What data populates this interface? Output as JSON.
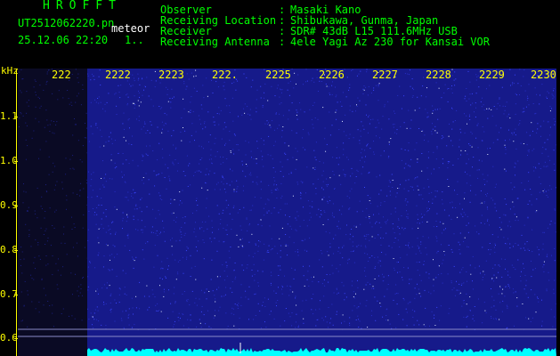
{
  "app": {
    "title": "HROFFT",
    "filename": "UT2512062220.pn",
    "event_type": "meteor",
    "datetime": "25.12.06 22:20",
    "counter": "1..",
    "color": "#00ff00",
    "info_color": "#00ff00",
    "meteor_color": "#ffffff"
  },
  "metadata": [
    {
      "label": "Observer",
      "value": "Masaki Kano"
    },
    {
      "label": "Receiving Location",
      "value": "Shibukawa, Gunma, Japan"
    },
    {
      "label": "Receiver",
      "value": "SDR# 43dB L15 111.6MHz USB"
    },
    {
      "label": "Receiving Antenna",
      "value": "4ele Yagi Az 230 for Kansai VOR"
    }
  ],
  "separator": ":",
  "spectrogram": {
    "unit_label": "kHz",
    "time_labels": [
      "222",
      "2222",
      "2223",
      "222.",
      "2225",
      "2226",
      "2227",
      "2228",
      "2229",
      "2230"
    ],
    "freq_labels": [
      "1.1",
      "1.0",
      "0.9",
      "0.8",
      "0.7",
      "0.6"
    ],
    "background_color": "#161a8a",
    "noise_color": "#3a46ff",
    "signal_color": "#00ffff",
    "label_color": "#ffff00"
  }
}
